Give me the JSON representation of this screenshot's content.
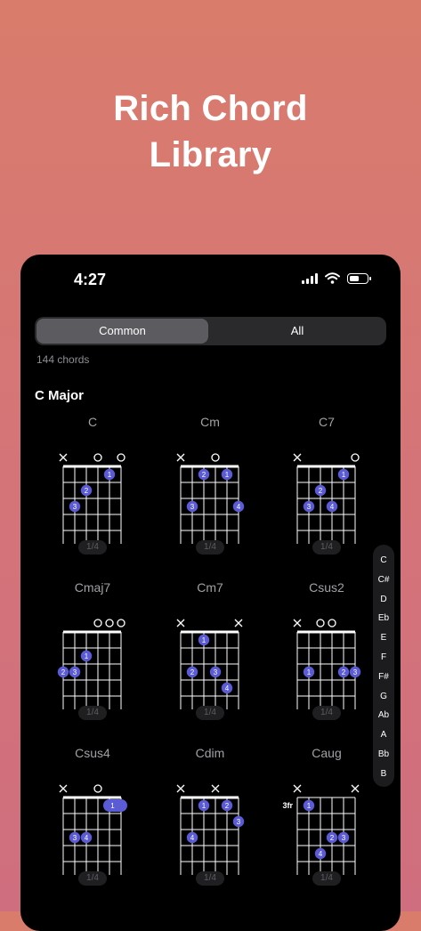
{
  "promo": {
    "line1": "Rich Chord",
    "line2": "Library"
  },
  "status_bar": {
    "time": "4:27",
    "battery_level": 0.6
  },
  "segmented": {
    "options": [
      "Common",
      "All"
    ],
    "selected": "Common"
  },
  "chord_count": "144 chords",
  "section": {
    "title": "C Major"
  },
  "chords": [
    {
      "name": "C",
      "page": "1/4",
      "open": [
        "x",
        "",
        "",
        "o",
        "",
        "o"
      ],
      "fret_label": "",
      "barre": null,
      "dots": [
        {
          "s": 5,
          "f": 1,
          "n": "1"
        },
        {
          "s": 3,
          "f": 2,
          "n": "2"
        },
        {
          "s": 2,
          "f": 3,
          "n": "3"
        }
      ]
    },
    {
      "name": "Cm",
      "page": "1/4",
      "open": [
        "x",
        "",
        "",
        "o",
        "",
        ""
      ],
      "fret_label": "",
      "barre": null,
      "dots": [
        {
          "s": 3,
          "f": 1,
          "n": "2"
        },
        {
          "s": 5,
          "f": 1,
          "n": "1"
        },
        {
          "s": 2,
          "f": 3,
          "n": "3"
        },
        {
          "s": 6,
          "f": 3,
          "n": "4"
        }
      ]
    },
    {
      "name": "C7",
      "page": "1/4",
      "open": [
        "x",
        "",
        "",
        "",
        "",
        "o"
      ],
      "fret_label": "",
      "barre": null,
      "dots": [
        {
          "s": 5,
          "f": 1,
          "n": "1"
        },
        {
          "s": 3,
          "f": 2,
          "n": "2"
        },
        {
          "s": 2,
          "f": 3,
          "n": "3"
        },
        {
          "s": 4,
          "f": 3,
          "n": "4"
        }
      ]
    },
    {
      "name": "Cmaj7",
      "page": "1/4",
      "open": [
        "",
        "",
        "",
        "o",
        "o",
        "o"
      ],
      "fret_label": "",
      "barre": null,
      "dots": [
        {
          "s": 3,
          "f": 2,
          "n": "1"
        },
        {
          "s": 1,
          "f": 3,
          "n": "2"
        },
        {
          "s": 2,
          "f": 3,
          "n": "3"
        }
      ]
    },
    {
      "name": "Cm7",
      "page": "1/4",
      "open": [
        "x",
        "",
        "",
        "",
        "",
        "x"
      ],
      "fret_label": "",
      "barre": null,
      "dots": [
        {
          "s": 3,
          "f": 1,
          "n": "1"
        },
        {
          "s": 2,
          "f": 3,
          "n": "2"
        },
        {
          "s": 4,
          "f": 3,
          "n": "3"
        },
        {
          "s": 5,
          "f": 4,
          "n": "4"
        }
      ]
    },
    {
      "name": "Csus2",
      "page": "1/4",
      "open": [
        "x",
        "",
        "o",
        "o",
        "",
        ""
      ],
      "fret_label": "",
      "barre": null,
      "dots": [
        {
          "s": 2,
          "f": 3,
          "n": "1"
        },
        {
          "s": 5,
          "f": 3,
          "n": "2"
        },
        {
          "s": 6,
          "f": 3,
          "n": "3"
        }
      ]
    },
    {
      "name": "Csus4",
      "page": "1/4",
      "open": [
        "x",
        "",
        "",
        "o",
        "",
        ""
      ],
      "fret_label": "",
      "barre": {
        "from": 5,
        "to": 6,
        "f": 1,
        "n": "1"
      },
      "dots": [
        {
          "s": 2,
          "f": 3,
          "n": "3"
        },
        {
          "s": 3,
          "f": 3,
          "n": "4"
        }
      ]
    },
    {
      "name": "Cdim",
      "page": "1/4",
      "open": [
        "x",
        "",
        "",
        "x",
        "",
        ""
      ],
      "fret_label": "",
      "barre": null,
      "dots": [
        {
          "s": 3,
          "f": 1,
          "n": "1"
        },
        {
          "s": 5,
          "f": 1,
          "n": "2"
        },
        {
          "s": 6,
          "f": 2,
          "n": "3"
        },
        {
          "s": 2,
          "f": 3,
          "n": "4"
        }
      ]
    },
    {
      "name": "Caug",
      "page": "1/4",
      "open": [
        "x",
        "",
        "",
        "",
        "",
        "x"
      ],
      "fret_label": "3fr",
      "barre": null,
      "dots": [
        {
          "s": 2,
          "f": 1,
          "n": "1"
        },
        {
          "s": 4,
          "f": 3,
          "n": "2"
        },
        {
          "s": 5,
          "f": 3,
          "n": "3"
        },
        {
          "s": 3,
          "f": 4,
          "n": "4"
        }
      ]
    }
  ],
  "index_letters": [
    "C",
    "C#",
    "D",
    "Eb",
    "E",
    "F",
    "F#",
    "G",
    "Ab",
    "A",
    "Bb",
    "B"
  ],
  "colors": {
    "finger_dot": "#5b5bd6",
    "background_top": "#d97c6c",
    "background_bottom": "#cf6e7e"
  }
}
